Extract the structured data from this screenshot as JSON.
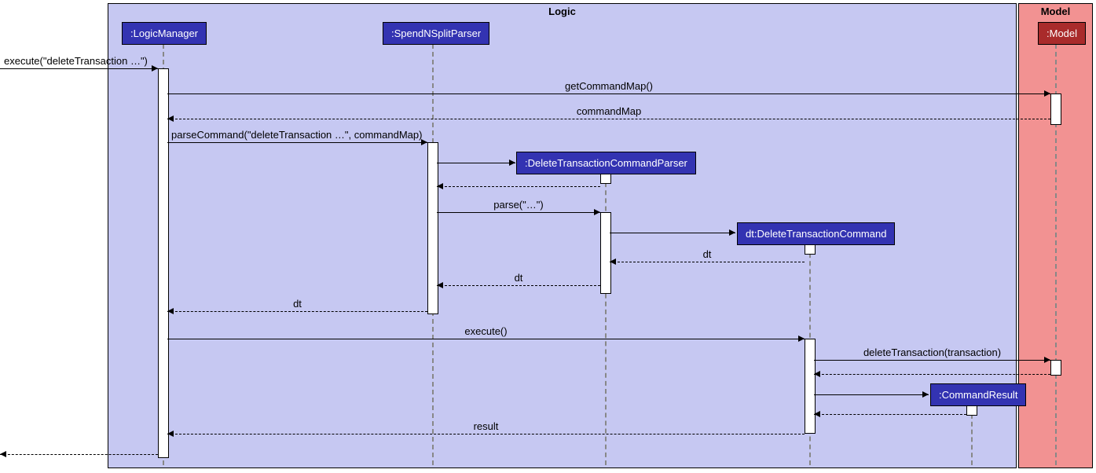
{
  "frames": {
    "logic": "Logic",
    "model": "Model"
  },
  "participants": {
    "logicManager": ":LogicManager",
    "spendNSplitParser": ":SpendNSplitParser",
    "deleteTxnParser": ":DeleteTransactionCommandParser",
    "deleteTxnCmd": "dt:DeleteTransactionCommand",
    "cmdResult": ":CommandResult",
    "model": ":Model"
  },
  "messages": {
    "m1": "execute(\"deleteTransaction …\")",
    "m2": "getCommandMap()",
    "m3": "commandMap",
    "m4": "parseCommand(\"deleteTransaction …\", commandMap)",
    "m5_ret": "",
    "m6": "parse(\"…\")",
    "m7_create": "",
    "m8": "dt",
    "m9": "dt",
    "m10": "dt",
    "m11": "execute()",
    "m12": "deleteTransaction(transaction)",
    "m13_ret": "",
    "m14_create": "",
    "m15_ret": "",
    "m16": "result",
    "m17_ret": ""
  }
}
